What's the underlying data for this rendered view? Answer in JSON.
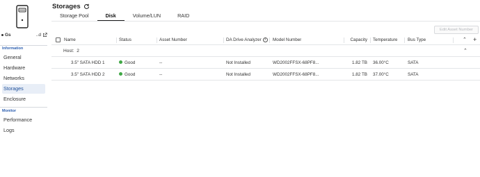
{
  "sidebar": {
    "device_name": "Gs",
    "device_name_tail": "..d",
    "sections": [
      {
        "title": "Information"
      },
      {
        "title": "Monitor"
      }
    ],
    "items": [
      {
        "label": "General"
      },
      {
        "label": "Hardware"
      },
      {
        "label": "Networks"
      },
      {
        "label": "Storages",
        "active": true
      },
      {
        "label": "Enclosure"
      },
      {
        "label": "Performance"
      },
      {
        "label": "Logs"
      }
    ]
  },
  "header": {
    "title": "Storages",
    "refresh_icon": "refresh-icon"
  },
  "tabs": [
    {
      "label": "Storage Pool"
    },
    {
      "label": "Disk",
      "active": true
    },
    {
      "label": "Volume/LUN"
    },
    {
      "label": "RAID"
    }
  ],
  "toolbar": {
    "edit_asset_label": "Edit Asset Number"
  },
  "table": {
    "columns": [
      "Name",
      "Status",
      "Asset Number",
      "DA Drive Analyzer",
      "Model Number",
      "Capacity",
      "Temperature",
      "Bus Type"
    ],
    "group": {
      "label": "Host:",
      "count": "2"
    },
    "rows": [
      {
        "name": "3.5\" SATA HDD 1",
        "status": "Good",
        "asset": "--",
        "analyzer": "Not Installed",
        "model": "WD2002FFSX-68PF8...",
        "capacity": "1.82 TB",
        "temperature": "36.00°C",
        "bus": "SATA"
      },
      {
        "name": "3.5\" SATA HDD 2",
        "status": "Good",
        "asset": "--",
        "analyzer": "Not Installed",
        "model": "WD2002FFSX-68PF8...",
        "capacity": "1.82 TB",
        "temperature": "37.00°C",
        "bus": "SATA"
      }
    ]
  },
  "colors": {
    "status_good": "#3fa745",
    "active_nav_bg": "#e8eef7",
    "section_head": "#2d5fb0"
  }
}
